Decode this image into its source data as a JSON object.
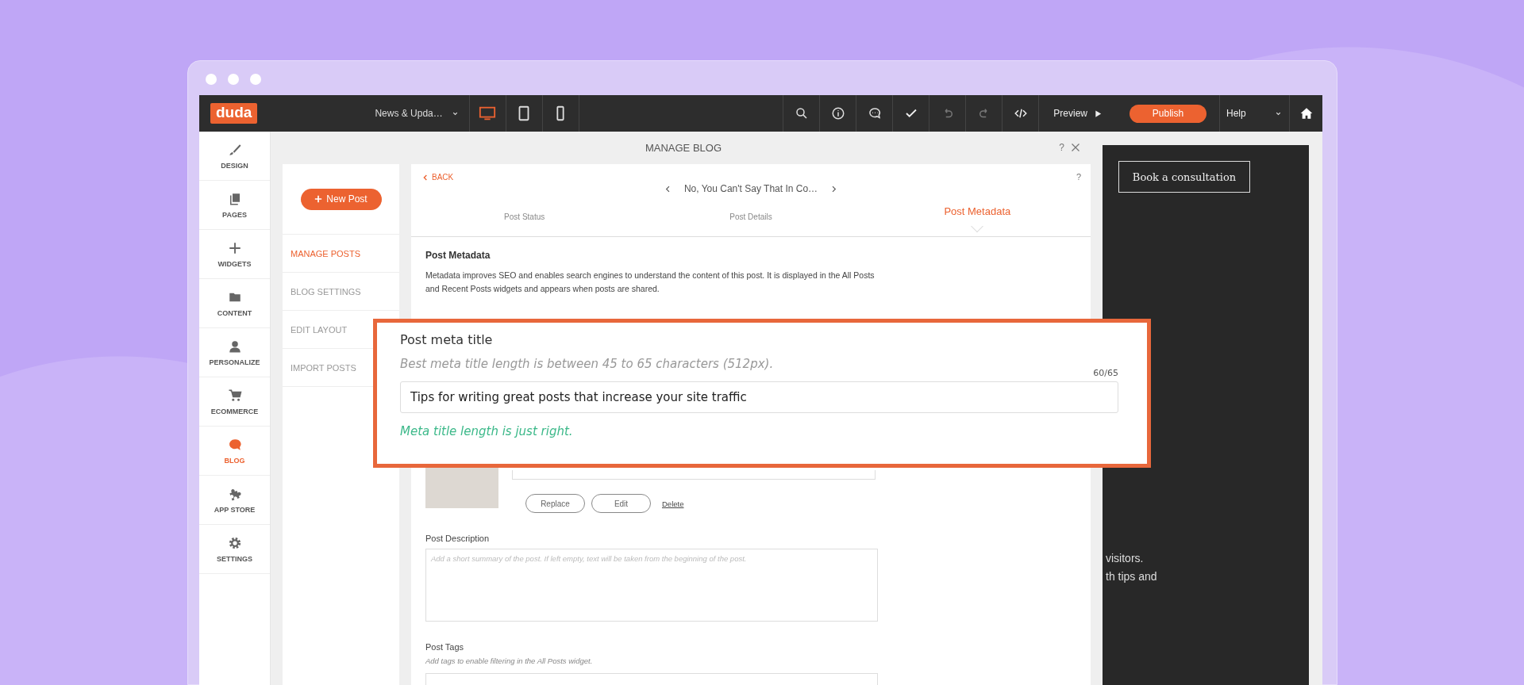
{
  "topbar": {
    "logo": "duda",
    "page_selector": "News & Upda…",
    "devices": [
      {
        "kind": "desktop",
        "selected": true
      },
      {
        "kind": "tablet",
        "selected": false
      },
      {
        "kind": "phone",
        "selected": false
      }
    ],
    "tools": [
      {
        "kind": "search"
      },
      {
        "kind": "info"
      },
      {
        "kind": "comment"
      },
      {
        "kind": "check"
      },
      {
        "kind": "undo"
      },
      {
        "kind": "redo"
      },
      {
        "kind": "code"
      }
    ],
    "preview": "Preview",
    "publish": "Publish",
    "help": "Help"
  },
  "sidebar": {
    "items": [
      {
        "label": "DESIGN",
        "kind": "brush",
        "selected": false
      },
      {
        "label": "PAGES",
        "kind": "pages",
        "selected": false
      },
      {
        "label": "WIDGETS",
        "kind": "plus",
        "selected": false
      },
      {
        "label": "CONTENT",
        "kind": "folder",
        "selected": false
      },
      {
        "label": "PERSONALIZE",
        "kind": "person",
        "selected": false
      },
      {
        "label": "ECOMMERCE",
        "kind": "cart",
        "selected": false
      },
      {
        "label": "BLOG",
        "kind": "chat",
        "selected": true
      },
      {
        "label": "APP STORE",
        "kind": "puzzle",
        "selected": false
      },
      {
        "label": "SETTINGS",
        "kind": "gear",
        "selected": false
      }
    ]
  },
  "manage_blog": {
    "title": "MANAGE BLOG",
    "help": "?"
  },
  "blog_menu": {
    "new_post": "New Post",
    "items": [
      {
        "label": "MANAGE POSTS",
        "selected": true
      },
      {
        "label": "BLOG SETTINGS",
        "selected": false
      },
      {
        "label": "EDIT LAYOUT",
        "selected": false
      },
      {
        "label": "IMPORT POSTS",
        "selected": false
      }
    ]
  },
  "post_editor": {
    "back": "BACK",
    "post_title": "No, You Can't Say That In Co…",
    "help": "?",
    "tabs": [
      {
        "label": "Post Status",
        "selected": false
      },
      {
        "label": "Post Details",
        "selected": false
      },
      {
        "label": "Post Metadata",
        "selected": true
      }
    ],
    "section_title": "Post Metadata",
    "description": "Metadata improves SEO and enables search engines to understand the content of this post. It is displayed in the All Posts and Recent Posts widgets and appears when posts are shared.",
    "image_buttons": [
      "Replace",
      "Edit"
    ],
    "delete": "Delete",
    "description_field": {
      "label": "Post Description",
      "placeholder": "Add a short summary of the post. If left empty, text will be taken from the beginning of the post."
    },
    "tags_field": {
      "label": "Post Tags",
      "hint": "Add tags to enable filtering in the All Posts widget."
    }
  },
  "callout": {
    "label": "Post meta title",
    "hint": "Best meta title length is between 45 to 65 characters (512px).",
    "counter": "60/65",
    "value": "Tips for writing great posts that increase your site traffic",
    "status": "Meta title length is just right."
  },
  "site_preview": {
    "button": "Book a consultation",
    "text_lines": [
      "visitors.",
      "th tips and"
    ]
  }
}
